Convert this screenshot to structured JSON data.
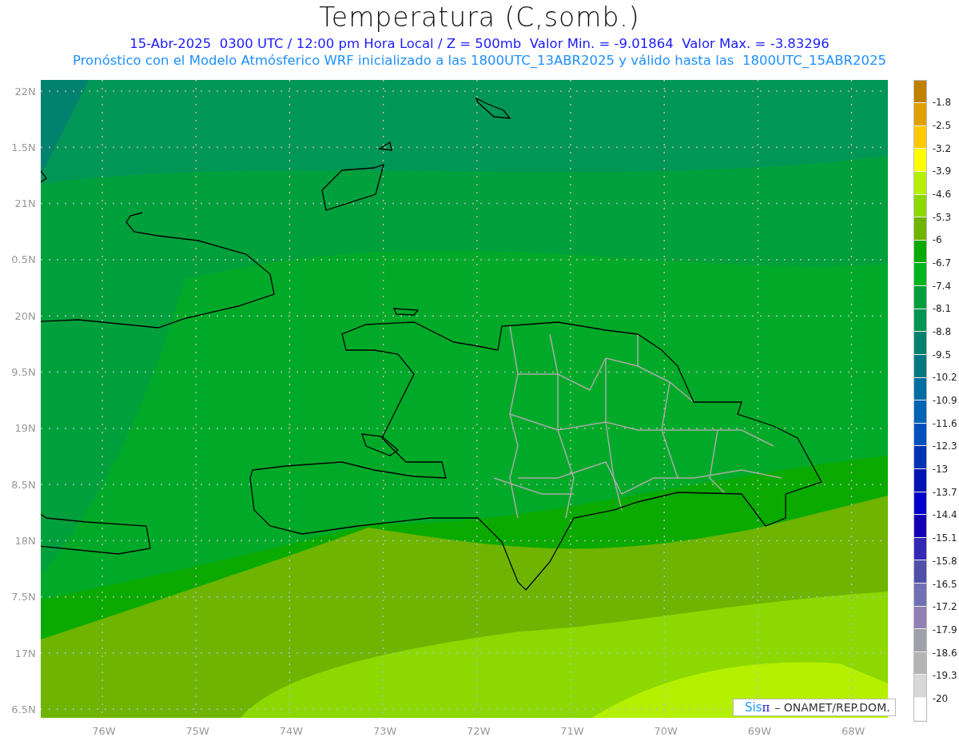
{
  "title": "Temperatura (C,somb.)",
  "subtitle": "15-Abr-2025  0300 UTC / 12:00 pm Hora Local / Z = 500mb  Valor Min. = -9.01864  Valor Max. = -3.83296",
  "note": "Pronóstico con el Modelo Atmósferico WRF inicializado a las 1800UTC_13ABR2025 y válido hasta las  1800UTC_15ABR2025",
  "y_axis": [
    "22N",
    "1.5N",
    "21N",
    "0.5N",
    "20N",
    "9.5N",
    "19N",
    "8.5N",
    "18N",
    "7.5N",
    "17N",
    "6.5N"
  ],
  "x_axis": [
    "76W",
    "75W",
    "74W",
    "73W",
    "72W",
    "71W",
    "70W",
    "69W",
    "68W"
  ],
  "colorbar": [
    {
      "color": "#c08000",
      "label": "-1.8"
    },
    {
      "color": "#e0a000",
      "label": "-2.5"
    },
    {
      "color": "#ffc800",
      "label": "-3.2"
    },
    {
      "color": "#ffff00",
      "label": "-3.9"
    },
    {
      "color": "#b4f000",
      "label": "-4.6"
    },
    {
      "color": "#8cd800",
      "label": "-5.3"
    },
    {
      "color": "#6eb400",
      "label": "-6"
    },
    {
      "color": "#0aaa00",
      "label": "-6.7"
    },
    {
      "color": "#00b41e",
      "label": "-7.4"
    },
    {
      "color": "#00a03c",
      "label": "-8.1"
    },
    {
      "color": "#009650",
      "label": "-8.8"
    },
    {
      "color": "#00826e",
      "label": "-9.5"
    },
    {
      "color": "#007882",
      "label": "-10.2"
    },
    {
      "color": "#006ea0",
      "label": "-10.9"
    },
    {
      "color": "#0064b4",
      "label": "-11.6"
    },
    {
      "color": "#0050be",
      "label": "-12.3"
    },
    {
      "color": "#0032b4",
      "label": "-13"
    },
    {
      "color": "#0014b4",
      "label": "-13.7"
    },
    {
      "color": "#0000c8",
      "label": "-14.4"
    },
    {
      "color": "#1400b4",
      "label": "-15.1"
    },
    {
      "color": "#3228b4",
      "label": "-15.8"
    },
    {
      "color": "#5050aa",
      "label": "-16.5"
    },
    {
      "color": "#7070b4",
      "label": "-17.2"
    },
    {
      "color": "#9080b4",
      "label": "-17.9"
    },
    {
      "color": "#a0a0aa",
      "label": "-18.6"
    },
    {
      "color": "#b4b4b4",
      "label": "-19.3"
    },
    {
      "color": "#d8d8d8",
      "label": "-20"
    },
    {
      "color": "#ffffff"
    }
  ],
  "credit": {
    "brand_prefix": "Sis",
    "brand_symbol": "π",
    "text": "– ONAMET/REP.DOM."
  }
}
